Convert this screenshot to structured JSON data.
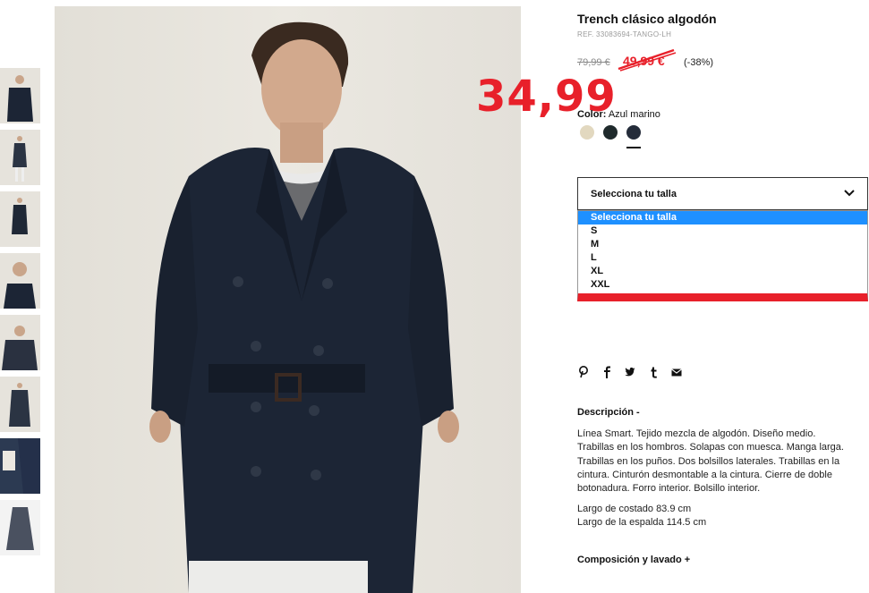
{
  "product": {
    "title": "Trench clásico algodón",
    "ref": "REF. 33083694-TANGO-LH",
    "old_price": "79,99 €",
    "sale_price": "49,99 €",
    "discount": "(-38%)",
    "overlay_price": "34,99"
  },
  "color": {
    "label": "Color:",
    "value": "Azul marino",
    "swatches": [
      {
        "name": "beige",
        "hex": "#e2d8bf"
      },
      {
        "name": "dark-green",
        "hex": "#1f2a2c"
      },
      {
        "name": "navy",
        "hex": "#242c3a"
      }
    ],
    "selected_index": 2
  },
  "size": {
    "placeholder": "Selecciona tu talla",
    "options": [
      "Selecciona tu talla",
      "S",
      "M",
      "L",
      "XL",
      "XXL"
    ]
  },
  "social": {
    "icons": [
      "pinterest-icon",
      "facebook-icon",
      "twitter-icon",
      "tumblr-icon",
      "email-icon"
    ],
    "glyphs": [
      "℗",
      "f",
      "🐦",
      "t",
      "✉"
    ]
  },
  "description": {
    "heading": "Descripción -",
    "lines": [
      "Línea Smart. Tejido mezcla de algodón. Diseño medio.",
      "Trabillas en los hombros. Solapas con muesca. Manga larga.",
      "Trabillas en los puños. Dos bolsillos laterales. Trabillas en la",
      "cintura. Cinturón desmontable a la cintura. Cierre de doble",
      "botonadura. Forro interior. Bolsillo interior."
    ],
    "dims": [
      "Largo de costado 83.9 cm",
      "Largo de la espalda 114.5 cm"
    ]
  },
  "composition": {
    "heading": "Composición y lavado +"
  },
  "colors": {
    "accent_red": "#e8202a",
    "select_blue": "#1e90ff",
    "coat_navy": "#1c2535"
  }
}
